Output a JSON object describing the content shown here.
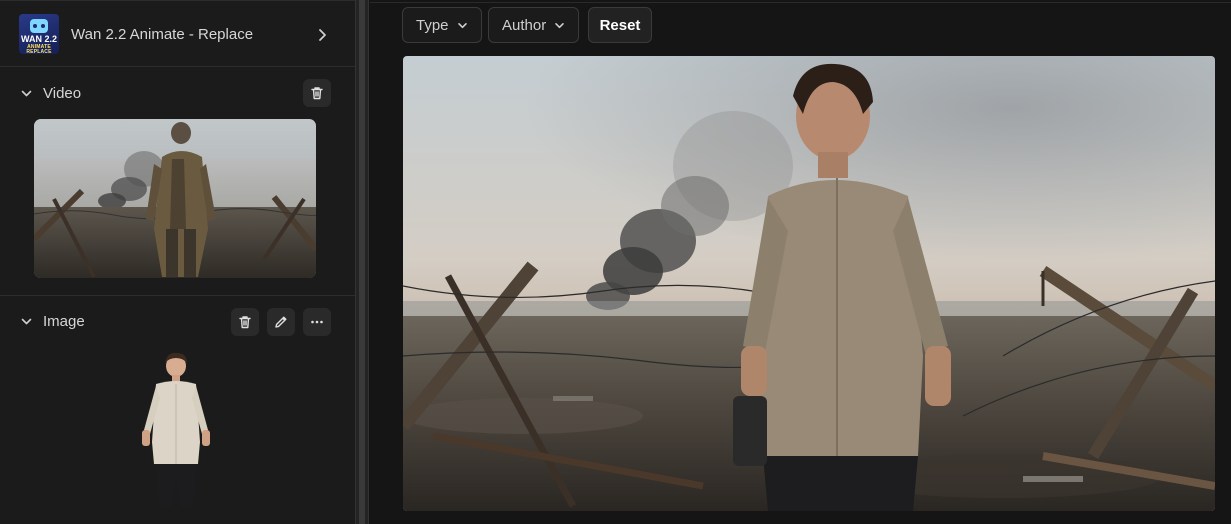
{
  "workflow": {
    "title": "Wan 2.2 Animate - Replace",
    "thumb_line1": "WAN 2.2",
    "thumb_line2": "ANIMATE REPLACE",
    "icon": "chevron-right-icon"
  },
  "sections": {
    "video": {
      "title": "Video",
      "actions": [
        "trash-icon"
      ]
    },
    "image": {
      "title": "Image",
      "actions": [
        "trash-icon",
        "pencil-icon",
        "more-horizontal-icon"
      ]
    }
  },
  "filters": {
    "type_label": "Type",
    "author_label": "Author",
    "reset_label": "Reset"
  },
  "colors": {
    "background": "#141414",
    "panel": "#1b1b1b",
    "button_border": "#3a3a3a",
    "text": "#d6d6d6"
  }
}
